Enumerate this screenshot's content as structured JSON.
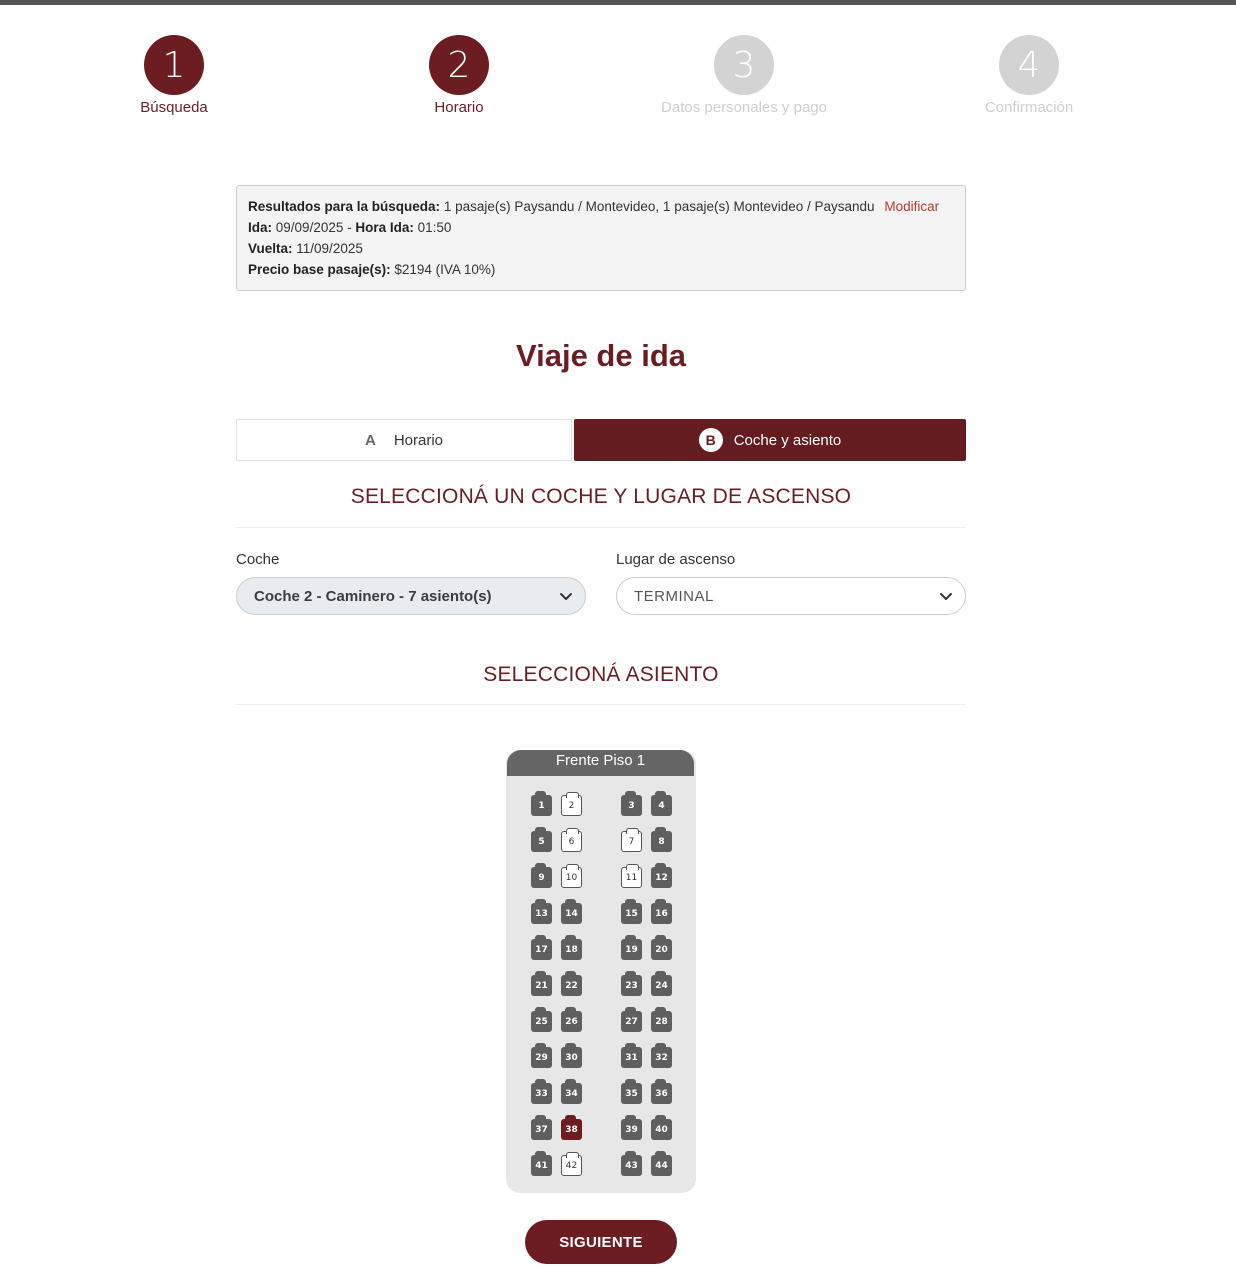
{
  "colors": {
    "primary": "#6b1d21",
    "inactive": "#d3d3d3",
    "seat_occupied": "#5f5f5f"
  },
  "steps": [
    {
      "number": "1",
      "label": "Búsqueda",
      "state": "active"
    },
    {
      "number": "2",
      "label": "Horario",
      "state": "active"
    },
    {
      "number": "3",
      "label": "Datos personales y pago",
      "state": "inactive"
    },
    {
      "number": "4",
      "label": "Confirmación",
      "state": "inactive"
    }
  ],
  "summary": {
    "results_label": "Resultados para la búsqueda:",
    "results_value": "1 pasaje(s) Paysandu / Montevideo, 1 pasaje(s) Montevideo / Paysandu",
    "modify_link": "Modificar",
    "ida_label": "Ida:",
    "ida_value": "09/09/2025",
    "separator": " - ",
    "hora_label": "Hora Ida:",
    "hora_value": "01:50",
    "vuelta_label": "Vuelta:",
    "vuelta_value": "11/09/2025",
    "price_label": "Precio base pasaje(s):",
    "price_value": "$2194 (IVA 10%)"
  },
  "main_title": "Viaje de ida",
  "tabs": [
    {
      "letter": "A",
      "label": "Horario"
    },
    {
      "letter": "B",
      "label": "Coche y asiento"
    }
  ],
  "section_coach_title": "SELECCIONÁ UN COCHE Y LUGAR DE ASCENSO",
  "coche": {
    "label": "Coche",
    "value": "Coche 2 - Caminero - 7 asiento(s)"
  },
  "lugar": {
    "label": "Lugar de ascenso",
    "value": "TERMINAL"
  },
  "section_seat_title": "SELECCIONÁ ASIENTO",
  "bus": {
    "header": "Frente Piso 1",
    "seats": [
      {
        "n": "1",
        "status": "occupied"
      },
      {
        "n": "2",
        "status": "free"
      },
      {
        "n": "3",
        "status": "occupied"
      },
      {
        "n": "4",
        "status": "occupied"
      },
      {
        "n": "5",
        "status": "occupied"
      },
      {
        "n": "6",
        "status": "free"
      },
      {
        "n": "7",
        "status": "free"
      },
      {
        "n": "8",
        "status": "occupied"
      },
      {
        "n": "9",
        "status": "occupied"
      },
      {
        "n": "10",
        "status": "free"
      },
      {
        "n": "11",
        "status": "free"
      },
      {
        "n": "12",
        "status": "occupied"
      },
      {
        "n": "13",
        "status": "occupied"
      },
      {
        "n": "14",
        "status": "occupied"
      },
      {
        "n": "15",
        "status": "occupied"
      },
      {
        "n": "16",
        "status": "occupied"
      },
      {
        "n": "17",
        "status": "occupied"
      },
      {
        "n": "18",
        "status": "occupied"
      },
      {
        "n": "19",
        "status": "occupied"
      },
      {
        "n": "20",
        "status": "occupied"
      },
      {
        "n": "21",
        "status": "occupied"
      },
      {
        "n": "22",
        "status": "occupied"
      },
      {
        "n": "23",
        "status": "occupied"
      },
      {
        "n": "24",
        "status": "occupied"
      },
      {
        "n": "25",
        "status": "occupied"
      },
      {
        "n": "26",
        "status": "occupied"
      },
      {
        "n": "27",
        "status": "occupied"
      },
      {
        "n": "28",
        "status": "occupied"
      },
      {
        "n": "29",
        "status": "occupied"
      },
      {
        "n": "30",
        "status": "occupied"
      },
      {
        "n": "31",
        "status": "occupied"
      },
      {
        "n": "32",
        "status": "occupied"
      },
      {
        "n": "33",
        "status": "occupied"
      },
      {
        "n": "34",
        "status": "occupied"
      },
      {
        "n": "35",
        "status": "occupied"
      },
      {
        "n": "36",
        "status": "occupied"
      },
      {
        "n": "37",
        "status": "occupied"
      },
      {
        "n": "38",
        "status": "selected"
      },
      {
        "n": "39",
        "status": "occupied"
      },
      {
        "n": "40",
        "status": "occupied"
      },
      {
        "n": "41",
        "status": "occupied"
      },
      {
        "n": "42",
        "status": "free"
      },
      {
        "n": "43",
        "status": "occupied"
      },
      {
        "n": "44",
        "status": "occupied"
      }
    ]
  },
  "next_button": "SIGUIENTE"
}
